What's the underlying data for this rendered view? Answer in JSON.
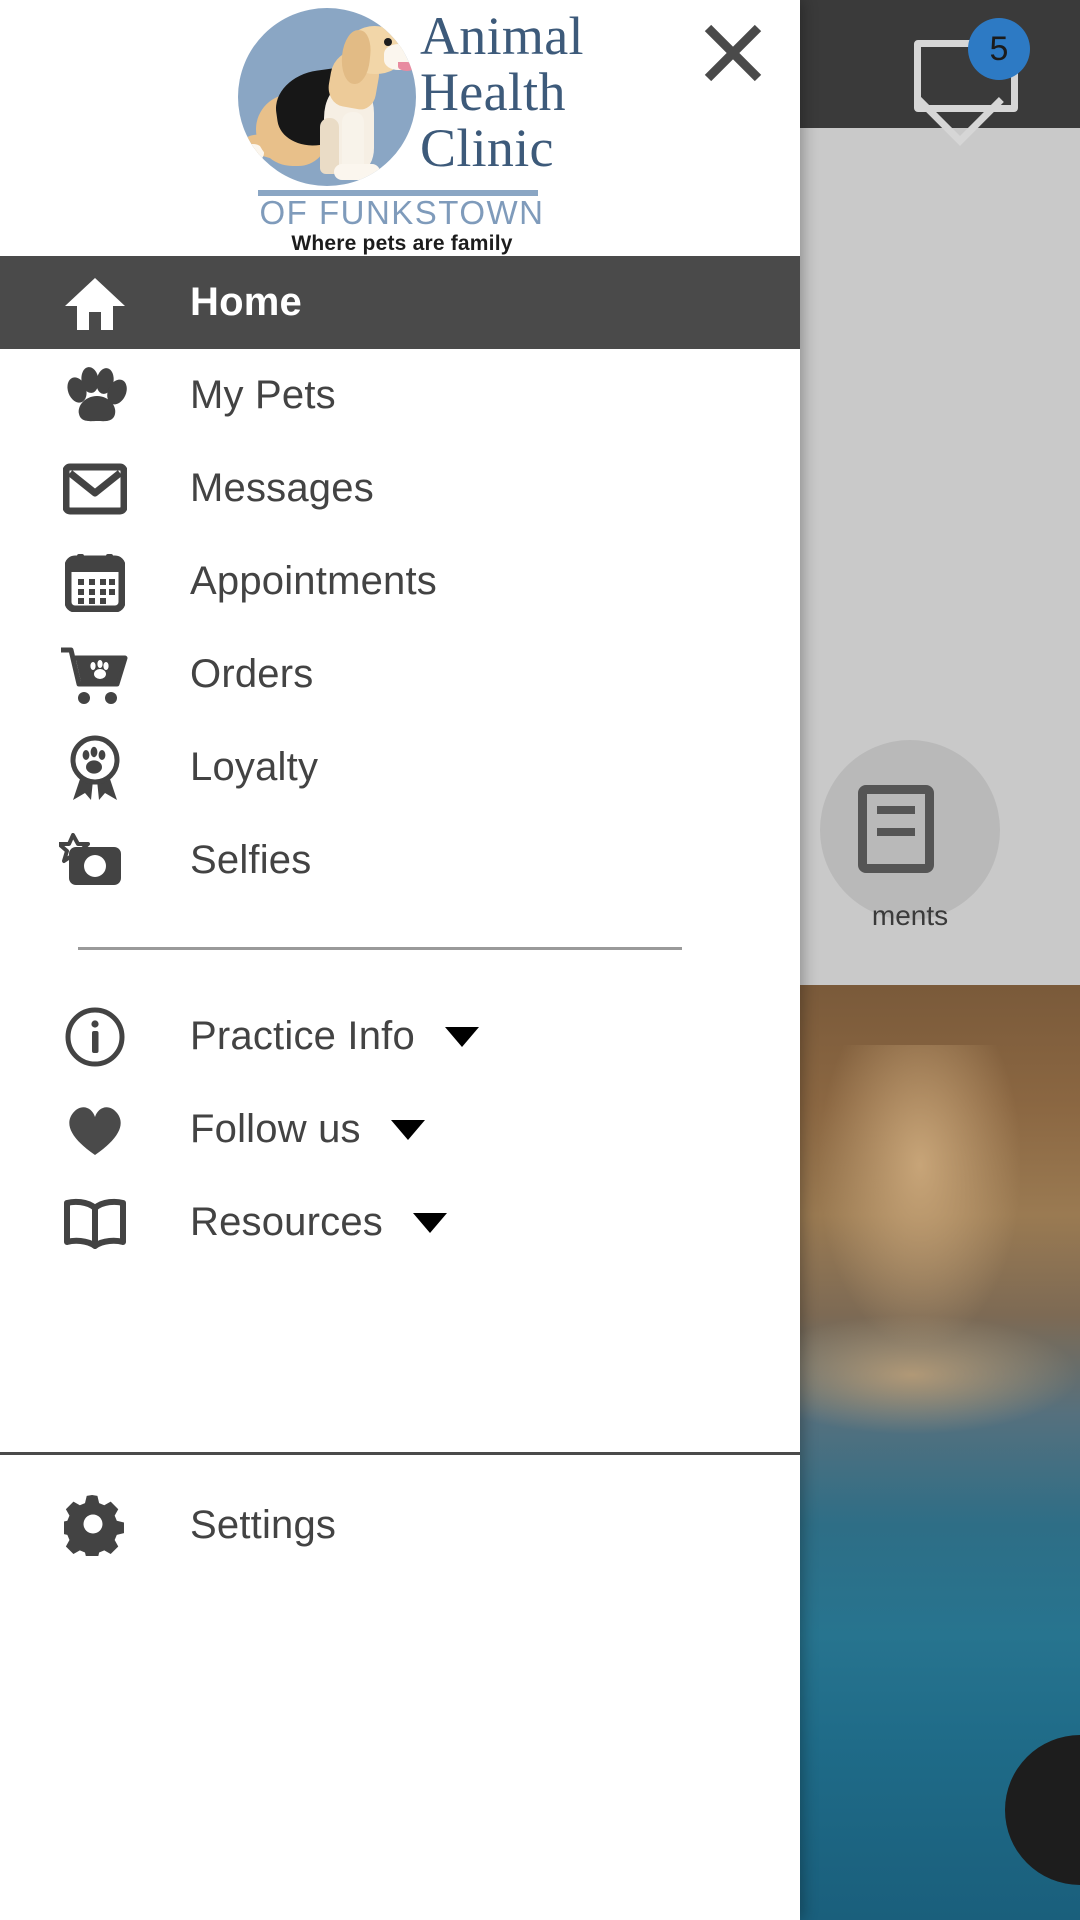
{
  "background": {
    "mail_icon": "mail-icon",
    "unread_badge": "5",
    "card_label": "ments",
    "card_icon": "appointments-card-icon"
  },
  "drawer": {
    "close_icon": "close-icon",
    "logo": {
      "line1": "Animal",
      "line2": "Health",
      "line3": "Clinic",
      "subtitle": "OF FUNKSTOWN",
      "tagline": "Where pets are family",
      "brand_blue": "#3d5a7a",
      "badge_blue": "#8aa6c4"
    },
    "nav": [
      {
        "label": "Home",
        "icon": "home-icon",
        "active": true,
        "caret": false
      },
      {
        "label": "My Pets",
        "icon": "paw-icon",
        "active": false,
        "caret": false
      },
      {
        "label": "Messages",
        "icon": "mail-icon",
        "active": false,
        "caret": false
      },
      {
        "label": "Appointments",
        "icon": "calendar-icon",
        "active": false,
        "caret": false
      },
      {
        "label": "Orders",
        "icon": "shopping-cart-paw-icon",
        "active": false,
        "caret": false
      },
      {
        "label": "Loyalty",
        "icon": "award-ribbon-paw-icon",
        "active": false,
        "caret": false
      },
      {
        "label": "Selfies",
        "icon": "camera-star-icon",
        "active": false,
        "caret": false
      }
    ],
    "nav_secondary": [
      {
        "label": "Practice Info",
        "icon": "info-circle-icon",
        "caret": true
      },
      {
        "label": "Follow us",
        "icon": "heart-icon",
        "caret": true
      },
      {
        "label": "Resources",
        "icon": "book-icon",
        "caret": true
      }
    ],
    "footer": {
      "label": "Settings",
      "icon": "gear-icon"
    },
    "active_bg": "#4a4a4a",
    "text_color": "#434343"
  }
}
